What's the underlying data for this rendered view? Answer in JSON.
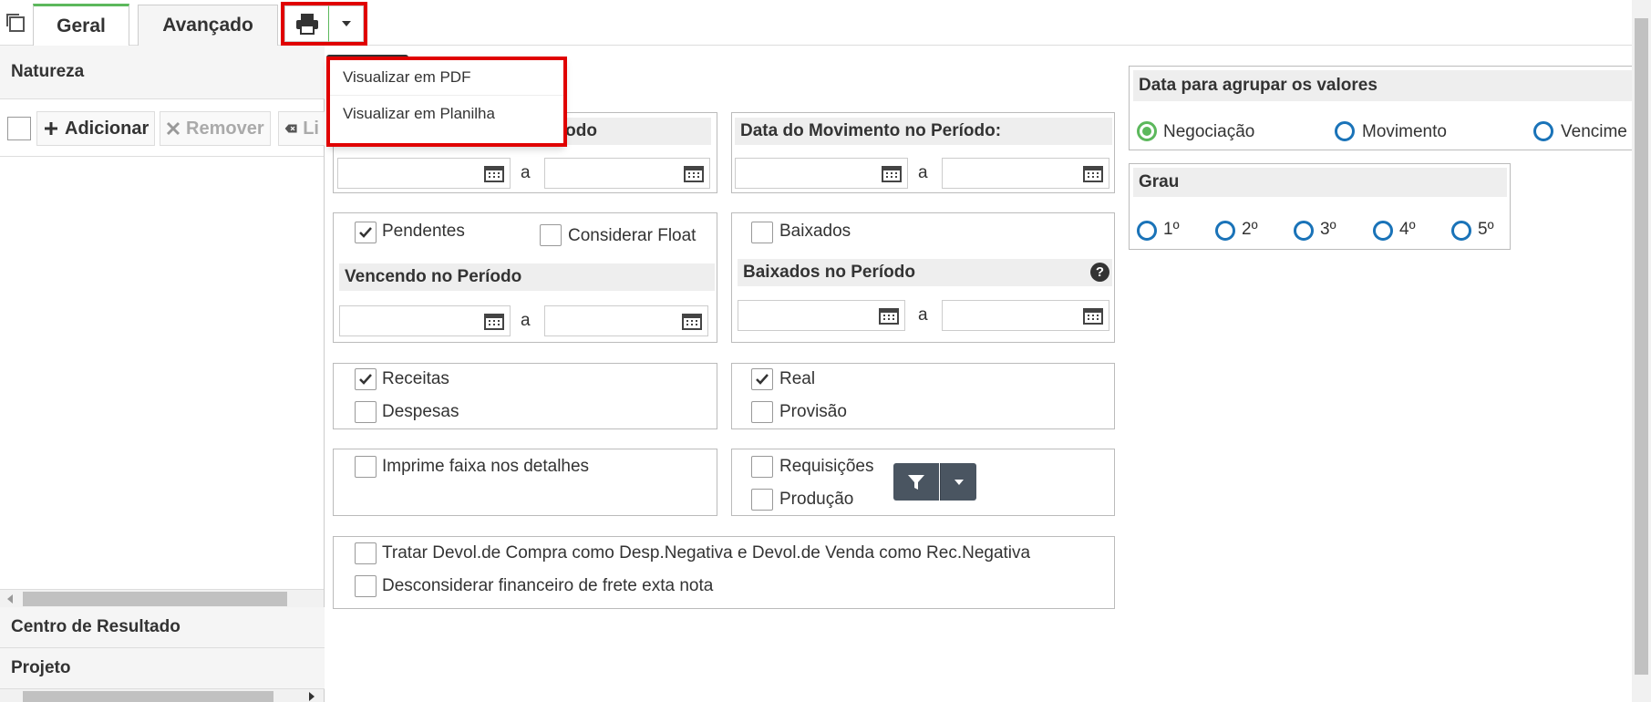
{
  "tabs": [
    {
      "label": "Geral"
    },
    {
      "label": "Avançado"
    }
  ],
  "print_menu": {
    "items": [
      "Visualizar em PDF",
      "Visualizar em Planilha"
    ]
  },
  "sidebar": {
    "natureza": "Natureza",
    "add_label": "Adicionar",
    "remove_label": "Remover",
    "clear_label": "Li",
    "centro": "Centro de Resultado",
    "projeto": "Projeto"
  },
  "main": {
    "periodo_label_partial": "íodo",
    "movimento_label": "Data do Movimento no Período:",
    "a": "a",
    "pendentes": "Pendentes",
    "considerar_float": "Considerar Float",
    "vencendo": "Vencendo no Período",
    "baixados": "Baixados",
    "baixados_periodo": "Baixados no Período",
    "receitas": "Receitas",
    "despesas": "Despesas",
    "real": "Real",
    "provisao": "Provisão",
    "imprime": "Imprime faixa nos detalhes",
    "requisicoes": "Requisições",
    "producao": "Produção",
    "tratar": "Tratar Devol.de Compra como Desp.Negativa e Devol.de Venda como Rec.Negativa",
    "desconsiderar": "Desconsiderar financeiro de frete exta nota"
  },
  "agrupar": {
    "title": "Data para agrupar os valores",
    "options": [
      "Negociação",
      "Movimento",
      "Vencime"
    ],
    "selected": "Negociação"
  },
  "grau": {
    "title": "Grau",
    "options": [
      "1º",
      "2º",
      "3º",
      "4º",
      "5º"
    ]
  },
  "colors": {
    "accent_green": "#5cb85c",
    "highlight_red": "#e00000",
    "radio_blue": "#1a73b8"
  },
  "checked": [
    "Pendentes",
    "Receitas",
    "Real"
  ]
}
